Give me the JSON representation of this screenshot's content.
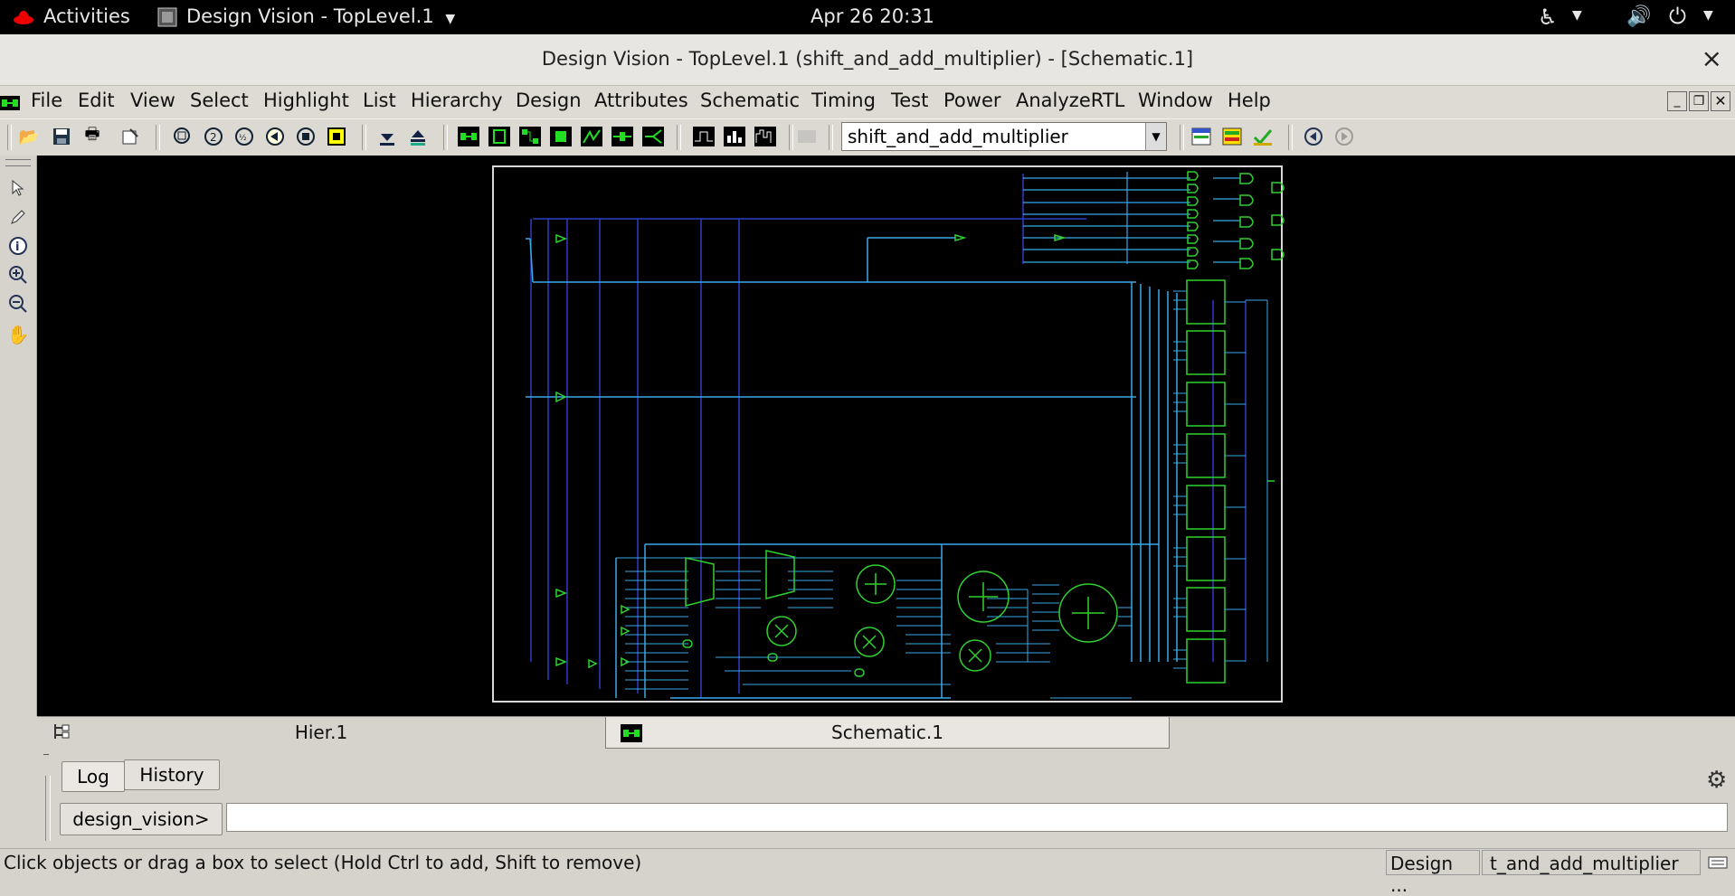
{
  "topbar": {
    "activities": "Activities",
    "app_menu": "Design Vision - TopLevel.1",
    "clock": "Apr 26  20:31"
  },
  "window": {
    "title": "Design Vision - TopLevel.1 (shift_and_add_multiplier) - [Schematic.1]",
    "close_glyph": "×"
  },
  "menubar": {
    "items": [
      "File",
      "Edit",
      "View",
      "Select",
      "Highlight",
      "List",
      "Hierarchy",
      "Design",
      "Attributes",
      "Schematic",
      "Timing",
      "Test",
      "Power",
      "AnalyzeRTL",
      "Window",
      "Help"
    ]
  },
  "toolbar": {
    "design_select_value": "shift_and_add_multiplier"
  },
  "tabs": {
    "hier": "Hier.1",
    "schematic": "Schematic.1"
  },
  "console": {
    "log_tab": "Log",
    "history_tab": "History",
    "prompt": "design_vision>",
    "input_value": ""
  },
  "status": {
    "message": "Click objects or drag a box to select (Hold Ctrl to add, Shift to remove)",
    "design_field": "Design ...",
    "design_value": "t_and_add_multiplier"
  },
  "colors": {
    "schematic_bg": "#000000",
    "wire": "#3aa8e8",
    "wire_dark": "#2a3fc8",
    "cell": "#2fd12f"
  }
}
